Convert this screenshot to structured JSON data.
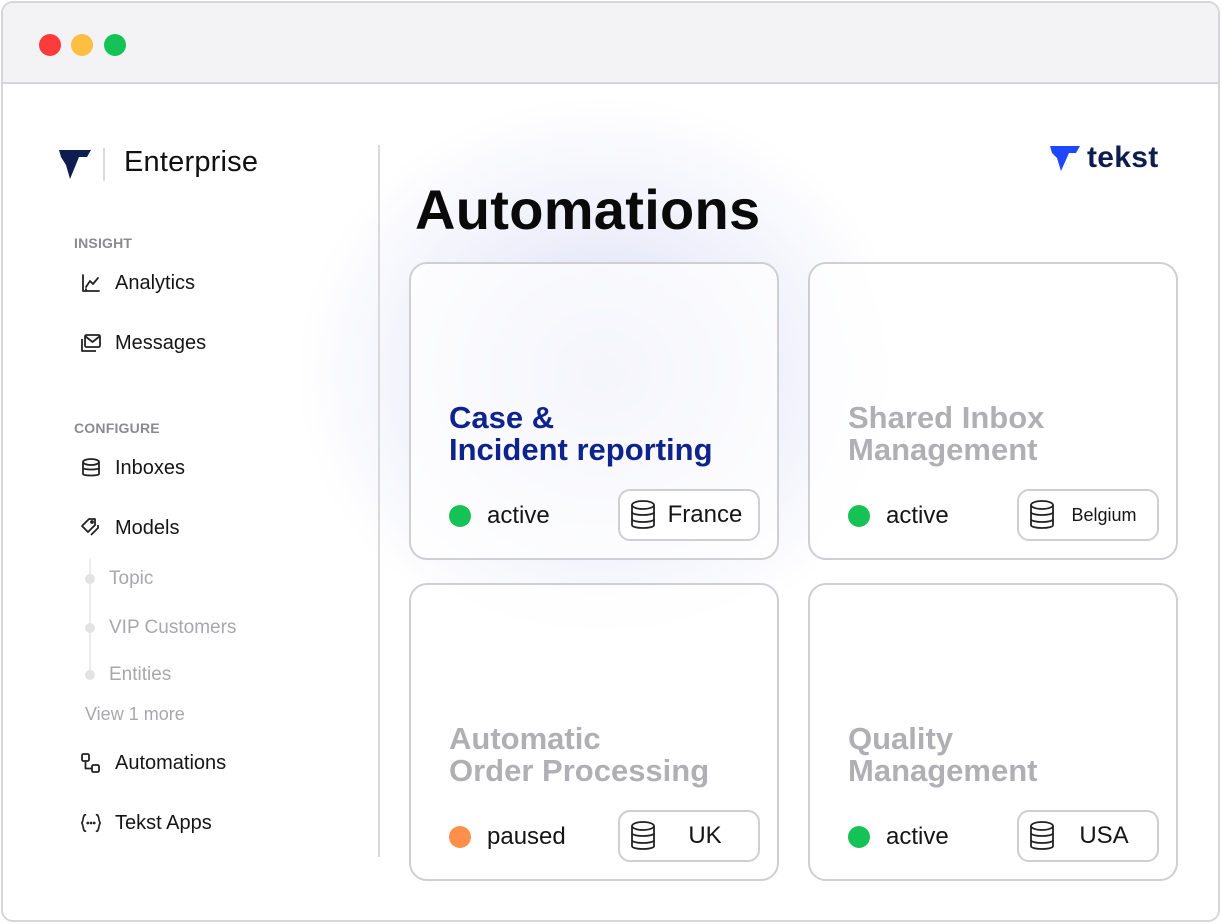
{
  "window": {
    "controls": [
      "close",
      "minimize",
      "maximize"
    ]
  },
  "sidebar": {
    "brand": {
      "name": "Enterprise",
      "icon": "tekst-logo-icon"
    },
    "sections": {
      "insight": "INSIGHT",
      "configure": "CONFIGURE"
    },
    "items": {
      "analytics": {
        "label": "Analytics",
        "icon": "chart-icon"
      },
      "messages": {
        "label": "Messages",
        "icon": "messages-icon"
      },
      "inboxes": {
        "label": "Inboxes",
        "icon": "database-icon"
      },
      "models": {
        "label": "Models",
        "icon": "tags-icon"
      },
      "automations": {
        "label": "Automations",
        "icon": "workflow-icon"
      },
      "tekst_apps": {
        "label": "Tekst Apps",
        "icon": "braces-icon"
      }
    },
    "models_children": [
      "Topic",
      "VIP Customers",
      "Entities"
    ],
    "view_more": "View 1 more"
  },
  "main": {
    "logo_text": "tekst",
    "title": "Automations",
    "cards": [
      {
        "title_line1": "Case &",
        "title_line2": "Incident reporting",
        "status": "active",
        "region": "France"
      },
      {
        "title_line1": "Shared Inbox",
        "title_line2": "Management",
        "status": "active",
        "region": "Belgium"
      },
      {
        "title_line1": "Automatic",
        "title_line2": "Order Processing",
        "status": "paused",
        "region": "UK"
      },
      {
        "title_line1": "Quality",
        "title_line2": "Management",
        "status": "active",
        "region": "USA"
      }
    ]
  },
  "colors": {
    "brand_navy": "#0d1d4e",
    "brand_blue": "#1f47ff",
    "highlight_title": "#0f238c",
    "status_active": "#15c255",
    "status_paused": "#ff8f4a",
    "muted_text": "#b0b0b4"
  }
}
